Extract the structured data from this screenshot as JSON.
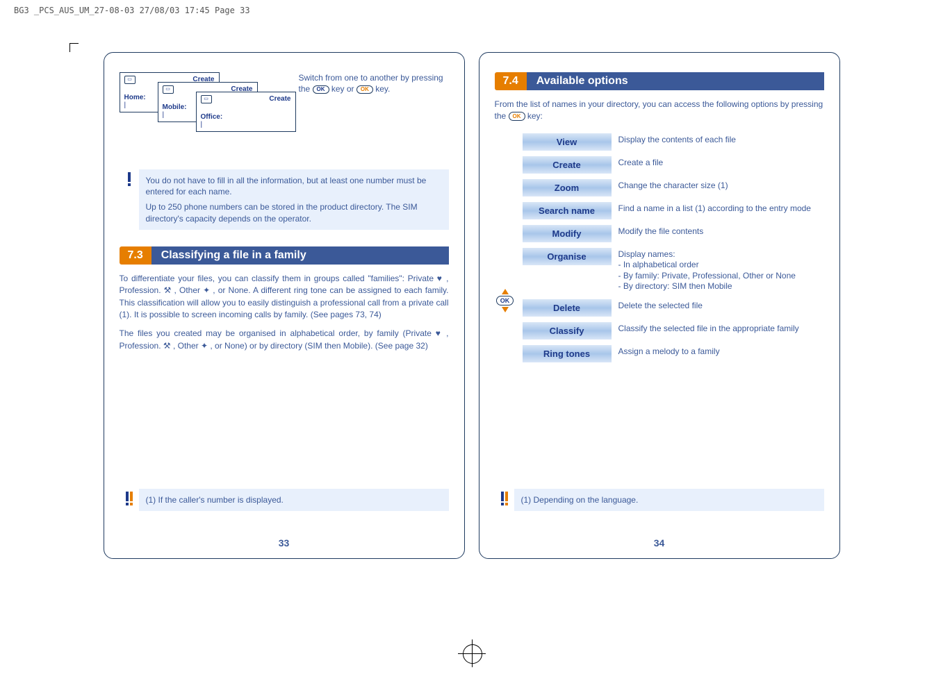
{
  "header_info": "BG3 _PCS_AUS_UM_27-08-03  27/08/03  17:45  Page 33",
  "left_page": {
    "cards": [
      {
        "title": "Create",
        "label": "Home:"
      },
      {
        "title": "Create",
        "label": "Mobile:"
      },
      {
        "title": "Create",
        "label": "Office:"
      }
    ],
    "switch_text_1": "Switch from one to another by pressing the ",
    "switch_text_2": " key or ",
    "switch_text_3": " key.",
    "ok": "OK",
    "note1_p1": "You do not have to fill in all the information, but at least one number must be entered for each name.",
    "note1_p2": "Up to 250 phone numbers can be stored in the product directory. The SIM directory's capacity depends on the operator.",
    "section_num": "7.3",
    "section_title": "Classifying a file in a family",
    "body1": "To differentiate your files, you can classify them in groups called \"families\": Private  ♥ , Profession.  ⚒ , Other  ✦ ,  or None.  A different ring tone can be assigned to each family. This classification will allow you to easily distinguish a professional call from a private call (1). It is possible to screen incoming calls by family. (See pages 73, 74)",
    "body2": "The files you created may be organised in alphabetical order, by family (Private  ♥ , Profession.  ⚒ , Other  ✦ , or None) or by directory (SIM then Mobile). (See page 32)",
    "footnote": "(1)  If the caller's number is displayed.",
    "page_num": "33"
  },
  "right_page": {
    "section_num": "7.4",
    "section_title": "Available options",
    "intro_1": "From the list of names in your directory, you can access the following options by pressing the ",
    "intro_2": " key:",
    "ok": "OK",
    "options": [
      {
        "label": "View",
        "desc": "Display the contents of each file"
      },
      {
        "label": "Create",
        "desc": "Create a file"
      },
      {
        "label": "Zoom",
        "desc": "Change the character size (1)"
      },
      {
        "label": "Search name",
        "desc": "Find a name in a list (1) according to the entry mode"
      },
      {
        "label": "Modify",
        "desc": "Modify the file contents"
      },
      {
        "label": "Organise",
        "desc": "Display names:\n- In alphabetical order\n- By family: Private, Professional, Other or None\n- By directory: SIM then Mobile"
      },
      {
        "label": "Delete",
        "desc": "Delete the selected file"
      },
      {
        "label": "Classify",
        "desc": "Classify the selected file in the appropriate family"
      },
      {
        "label": "Ring tones",
        "desc": "Assign a melody to a family"
      }
    ],
    "footnote": "(1)  Depending on the language.",
    "page_num": "34"
  }
}
